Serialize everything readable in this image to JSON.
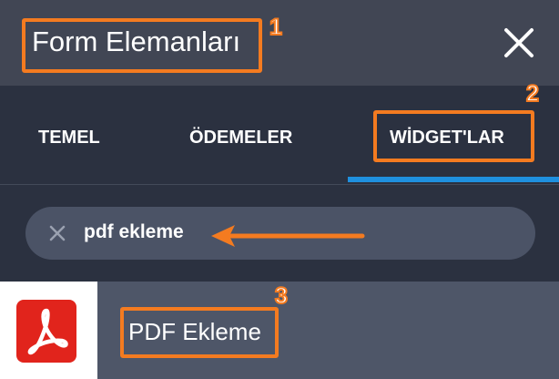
{
  "header": {
    "title": "Form Elemanları",
    "close_icon": "close-icon"
  },
  "tabs": [
    {
      "label": "TEMEL",
      "active": false
    },
    {
      "label": "ÖDEMELER",
      "active": false
    },
    {
      "label": "WİDGET'LAR",
      "active": true
    }
  ],
  "search": {
    "value": "pdf ekleme",
    "clear_icon": "clear-x-icon"
  },
  "results": [
    {
      "label": "PDF Ekleme",
      "icon": "pdf-icon"
    }
  ],
  "annotations": {
    "markers": [
      "1",
      "2",
      "3"
    ],
    "color": "#f47b20"
  },
  "colors": {
    "accent": "#1f90df",
    "pdf_red": "#e1241c"
  }
}
